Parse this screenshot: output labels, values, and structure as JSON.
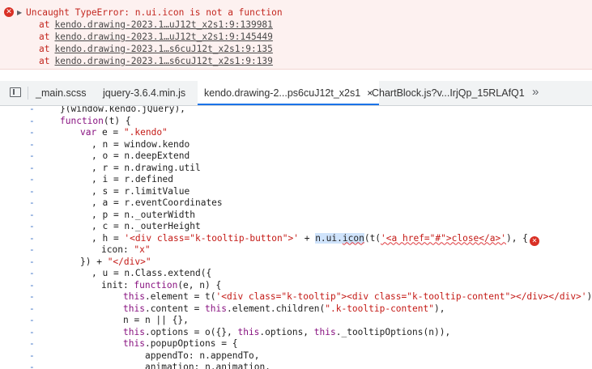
{
  "console": {
    "error_message": "Uncaught TypeError: n.ui.icon is not a function",
    "stack": [
      {
        "prefix": "at",
        "link": "kendo.drawing-2023.1…uJ12t_x2s1:9:139981"
      },
      {
        "prefix": "at",
        "link": "kendo.drawing-2023.1…uJ12t_x2s1:9:145449"
      },
      {
        "prefix": "at",
        "link": "kendo.drawing-2023.1…s6cuJ12t_x2s1:9:135"
      },
      {
        "prefix": "at",
        "link": "kendo.drawing-2023.1…s6cuJ12t_x2s1:9:139"
      }
    ],
    "icons": {
      "error": "error-circle-icon",
      "expand": "caret-right-icon"
    }
  },
  "tabs": {
    "items": [
      {
        "label": "_main.scss"
      },
      {
        "label": "jquery-3.6.4.min.js"
      },
      {
        "label": "kendo.drawing-2...ps6cuJ12t_x2s1",
        "close": "×"
      },
      {
        "label": "ChartBlock.js?v...IrjQp_15RLAfQ1"
      }
    ],
    "overflow": "»",
    "active_color": "#1a73e8"
  },
  "code": {
    "marker": "-",
    "colors": {
      "keyword": "#881280",
      "string": "#c41a16",
      "gutter": "#3d72c7",
      "error": "#d93025"
    }
  }
}
